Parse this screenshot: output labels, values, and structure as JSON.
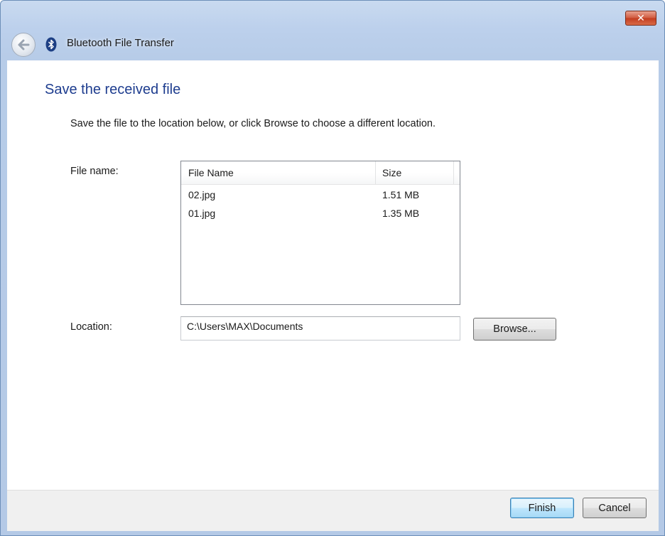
{
  "window": {
    "title": "Bluetooth File Transfer",
    "close_symbol": "✕"
  },
  "page": {
    "heading": "Save the received file",
    "instruction": "Save the file to the location below, or click Browse to choose a different location.",
    "file_name_label": "File name:",
    "location_label": "Location:"
  },
  "file_list": {
    "columns": {
      "name": "File Name",
      "size": "Size"
    },
    "rows": [
      {
        "name": "02.jpg",
        "size": "1.51 MB"
      },
      {
        "name": "01.jpg",
        "size": "1.35 MB"
      }
    ]
  },
  "location": {
    "value": "C:\\Users\\MAX\\Documents"
  },
  "buttons": {
    "browse": "Browse...",
    "finish": "Finish",
    "cancel": "Cancel"
  },
  "icons": {
    "back": "back-arrow-icon",
    "bluetooth": "bluetooth-icon",
    "close": "close-icon"
  },
  "colors": {
    "heading": "#1e3d8f",
    "frame": "#b7cce8",
    "close_button": "#c23c1f"
  }
}
